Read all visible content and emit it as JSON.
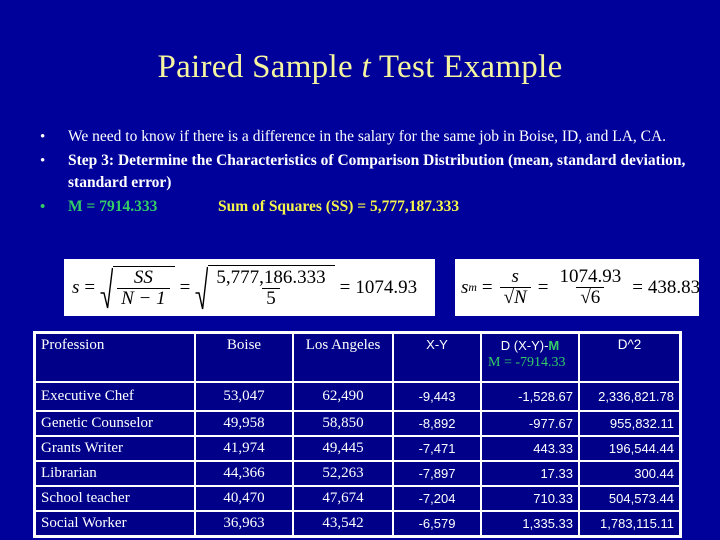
{
  "slide": {
    "title_part1": "Paired Sample ",
    "title_italic": "t",
    "title_part2": " Test Example",
    "background_color": "#00009B",
    "title_color": "#F5F5A0"
  },
  "bullets": [
    {
      "marker": "•",
      "marker_color": "#FFFFFF",
      "text": "We need to know if there is a difference in the salary for the same job in Boise, ID, and LA, CA."
    },
    {
      "marker": "•",
      "marker_color": "#FFFFFF",
      "text": "Step 3: Determine the Characteristics of Comparison Distribution (mean, standard deviation, standard error)"
    },
    {
      "marker": "•",
      "marker_color": "#33CC66",
      "mean_label": "M = 7914.333",
      "mean_color": "#33CC66",
      "ss_label": "Sum of Squares (SS) = 5,777,187.333",
      "ss_color": "#F5F54A"
    }
  ],
  "formulas": {
    "s": {
      "lhs": "s",
      "eq1": "=",
      "numerator1": "SS",
      "denominator1": "N − 1",
      "eq2": "=",
      "numerator2": "5,777,186.333",
      "denominator2": "5",
      "eq3": "=",
      "result": "1074.93"
    },
    "sm": {
      "lhs": "s",
      "lhs_sub": "m",
      "eq1": "=",
      "numerator1": "s",
      "denominator1": "√N",
      "eq2": "=",
      "numerator2": "1074.93",
      "denominator2": "√6",
      "eq3": "=",
      "result": "438.83"
    }
  },
  "table": {
    "headers": {
      "profession": "Profession",
      "boise": "Boise",
      "los_angeles": "Los Angeles",
      "x_minus_y": "X-Y",
      "d_line1_pre": "D  (X-Y)-",
      "d_line1_m": "M",
      "d_line2": "M = -7914.33",
      "d_squared": "D^2"
    },
    "rows": [
      {
        "profession": "Executive Chef",
        "boise": "53,047",
        "los_angeles": "62,490",
        "x_minus_y": "-9,443",
        "d": "-1,528.67",
        "d_squared": "2,336,821.78"
      },
      {
        "profession": "Genetic Counselor",
        "boise": "49,958",
        "los_angeles": "58,850",
        "x_minus_y": "-8,892",
        "d": "-977.67",
        "d_squared": "955,832.11"
      },
      {
        "profession": "Grants Writer",
        "boise": "41,974",
        "los_angeles": "49,445",
        "x_minus_y": "-7,471",
        "d": "443.33",
        "d_squared": "196,544.44"
      },
      {
        "profession": "Librarian",
        "boise": "44,366",
        "los_angeles": "52,263",
        "x_minus_y": "-7,897",
        "d": "17.33",
        "d_squared": "300.44"
      },
      {
        "profession": "School teacher",
        "boise": "40,470",
        "los_angeles": "47,674",
        "x_minus_y": "-7,204",
        "d": "710.33",
        "d_squared": "504,573.44"
      },
      {
        "profession": "Social Worker",
        "boise": "36,963",
        "los_angeles": "43,542",
        "x_minus_y": "-6,579",
        "d": "1,335.33",
        "d_squared": "1,783,115.11"
      }
    ]
  }
}
